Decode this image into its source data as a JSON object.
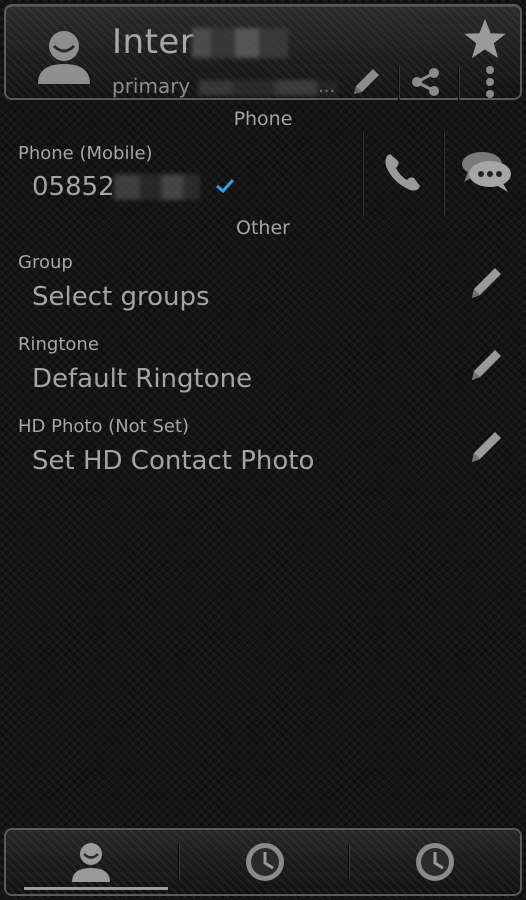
{
  "header": {
    "name_prefix": "Inter",
    "subtitle_prefix": "primary",
    "subtitle_suffix": "..."
  },
  "sections": {
    "phone_title": "Phone",
    "other_title": "Other"
  },
  "phone": {
    "label": "Phone  (Mobile)",
    "number_prefix": "05852"
  },
  "group": {
    "label": "Group",
    "value": "Select groups"
  },
  "ringtone": {
    "label": "Ringtone",
    "value": "Default Ringtone"
  },
  "hd_photo": {
    "label": "HD Photo (Not Set)",
    "value": "Set HD Contact Photo"
  },
  "icons": {
    "avatar": "person-icon",
    "star": "star-icon",
    "edit": "pencil-icon",
    "share": "share-icon",
    "menu": "overflow-menu-icon",
    "call": "phone-icon",
    "message": "chat-bubble-icon",
    "verified": "checkmark-icon",
    "tab_contact": "person-icon",
    "tab_history": "clock-icon"
  },
  "colors": {
    "background": "#141414",
    "text": "#a6a6a6",
    "accent_check": "#2ea0e6",
    "border": "#5a5a5a"
  }
}
